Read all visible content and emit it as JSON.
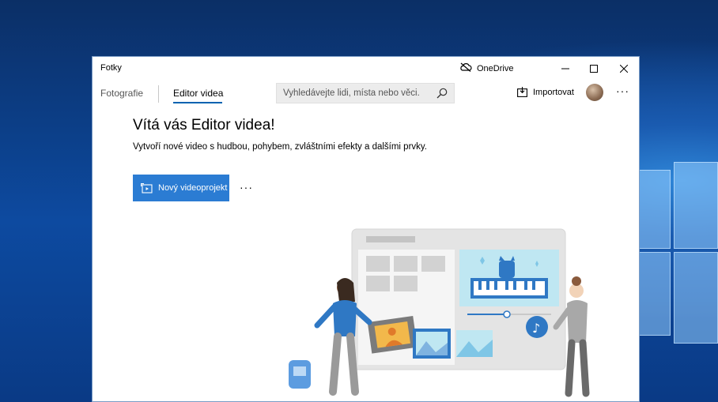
{
  "window": {
    "app_title": "Fotky",
    "onedrive_label": "OneDrive"
  },
  "nav": {
    "tab_photos": "Fotografie",
    "tab_editor": "Editor videa",
    "search_placeholder": "Vyhledávejte lidi, místa nebo věci.",
    "import_label": "Importovat",
    "more": "···"
  },
  "main": {
    "welcome_title": "Vítá vás Editor videa!",
    "subtitle": "Vytvoří nové video s hudbou, pohybem, zvláštními efekty a dalšími prvky.",
    "new_project_label": "Nový videoprojekt",
    "more": "···"
  },
  "colors": {
    "accent": "#2b7cd3",
    "tab_underline": "#0063b1"
  },
  "icons": [
    "cloud-icon",
    "minimize-icon",
    "maximize-icon",
    "close-icon",
    "search-icon",
    "import-icon",
    "new-project-icon"
  ]
}
